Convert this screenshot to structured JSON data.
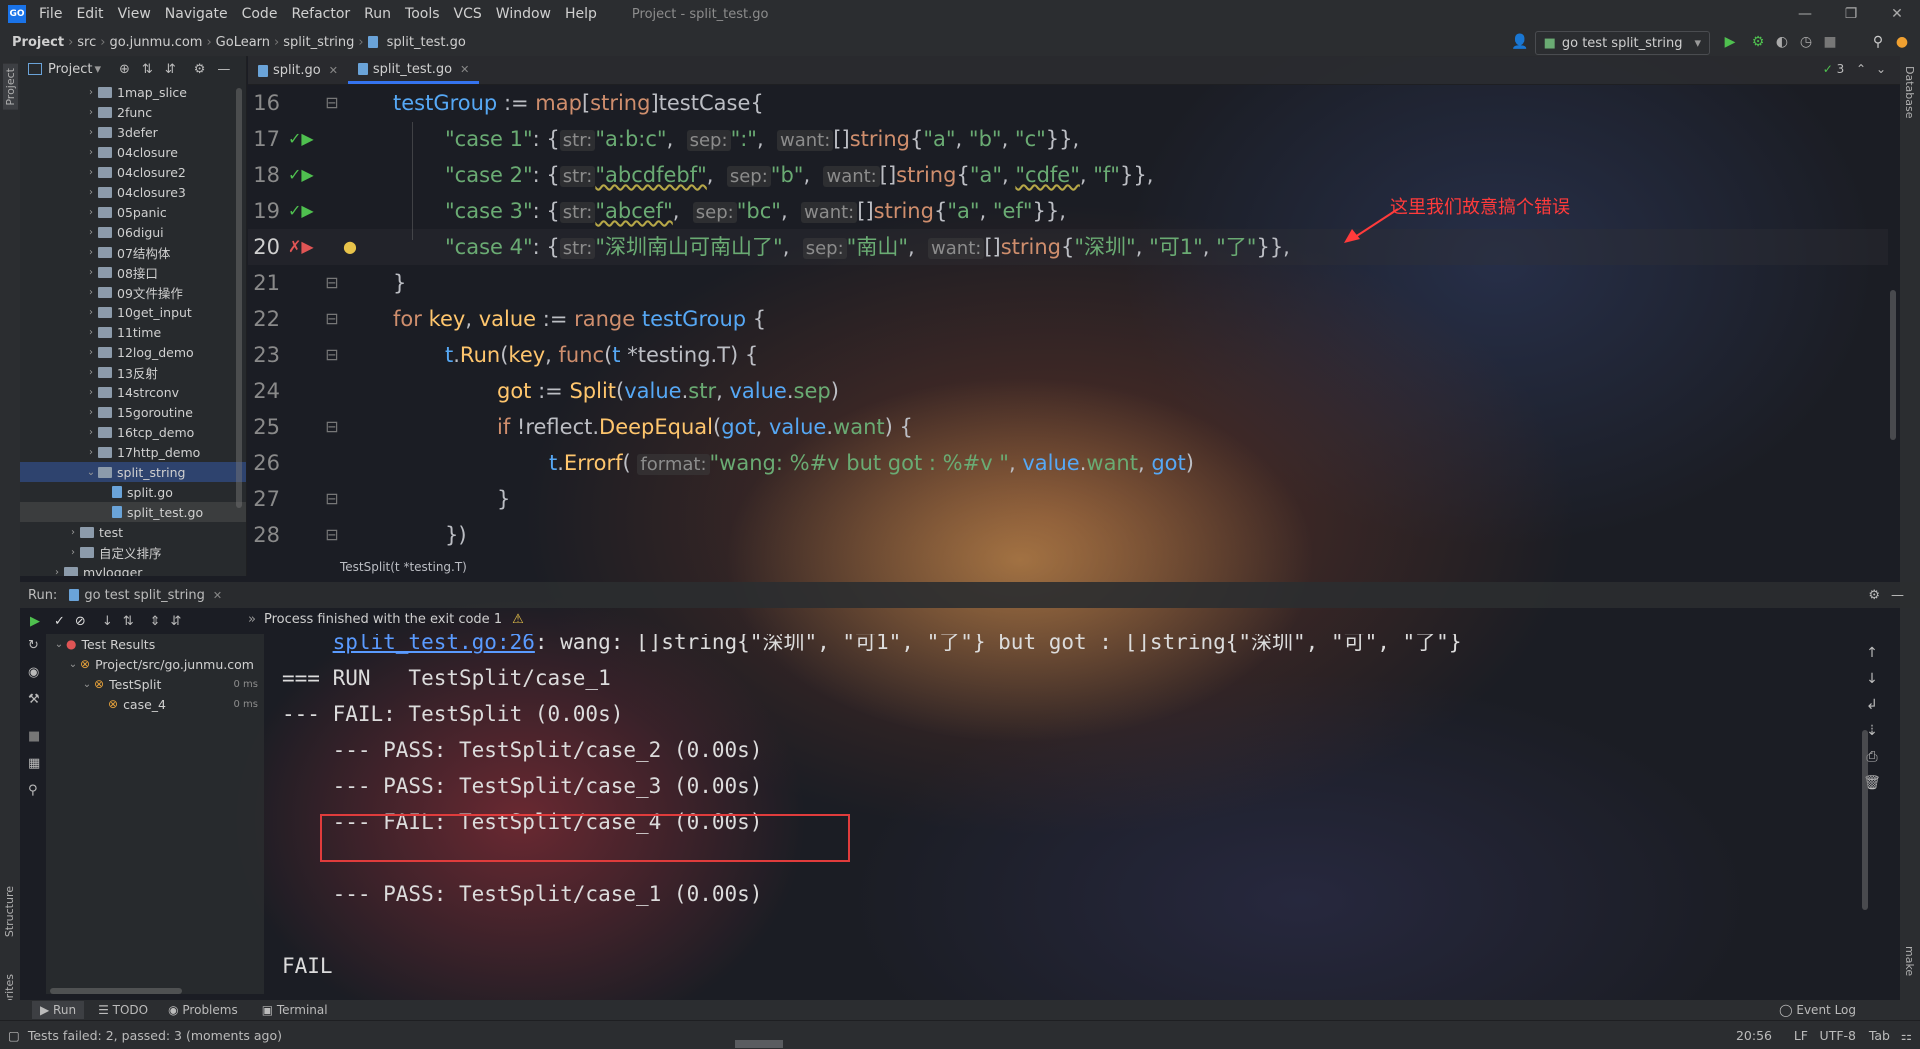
{
  "menubar": {
    "logo": "GO",
    "items": [
      "File",
      "Edit",
      "View",
      "Navigate",
      "Code",
      "Refactor",
      "Run",
      "Tools",
      "VCS",
      "Window",
      "Help"
    ],
    "title": "Project - split_test.go"
  },
  "breadcrumb": [
    "Project",
    "src",
    "go.junmu.com",
    "GoLearn",
    "split_string",
    "split_test.go"
  ],
  "run_config": "go test split_string",
  "project_panel": {
    "title": "Project",
    "tree": [
      {
        "label": "1map_slice",
        "indent": 1,
        "type": "folder"
      },
      {
        "label": "2func",
        "indent": 1,
        "type": "folder"
      },
      {
        "label": "3defer",
        "indent": 1,
        "type": "folder"
      },
      {
        "label": "04closure",
        "indent": 1,
        "type": "folder"
      },
      {
        "label": "04closure2",
        "indent": 1,
        "type": "folder"
      },
      {
        "label": "04closure3",
        "indent": 1,
        "type": "folder"
      },
      {
        "label": "05panic",
        "indent": 1,
        "type": "folder"
      },
      {
        "label": "06digui",
        "indent": 1,
        "type": "folder"
      },
      {
        "label": "07结构体",
        "indent": 1,
        "type": "folder"
      },
      {
        "label": "08接口",
        "indent": 1,
        "type": "folder"
      },
      {
        "label": "09文件操作",
        "indent": 1,
        "type": "folder"
      },
      {
        "label": "10get_input",
        "indent": 1,
        "type": "folder"
      },
      {
        "label": "11time",
        "indent": 1,
        "type": "folder"
      },
      {
        "label": "12log_demo",
        "indent": 1,
        "type": "folder"
      },
      {
        "label": "13反射",
        "indent": 1,
        "type": "folder"
      },
      {
        "label": "14strconv",
        "indent": 1,
        "type": "folder"
      },
      {
        "label": "15goroutine",
        "indent": 1,
        "type": "folder"
      },
      {
        "label": "16tcp_demo",
        "indent": 1,
        "type": "folder"
      },
      {
        "label": "17http_demo",
        "indent": 1,
        "type": "folder"
      },
      {
        "label": "split_string",
        "indent": 1,
        "type": "folder",
        "open": true,
        "selected": true
      },
      {
        "label": "split.go",
        "indent": 2,
        "type": "file"
      },
      {
        "label": "split_test.go",
        "indent": 2,
        "type": "file",
        "active": true
      },
      {
        "label": "test",
        "indent": 0,
        "type": "folder"
      },
      {
        "label": "自定义排序",
        "indent": 0,
        "type": "folder"
      },
      {
        "label": "mylogger",
        "indent": -1,
        "type": "folder"
      }
    ]
  },
  "tabs": [
    {
      "label": "split.go",
      "active": false
    },
    {
      "label": "split_test.go",
      "active": true
    }
  ],
  "editor": {
    "inspection_count": "3",
    "annotation": "这里我们故意搞个错误",
    "footer_crumb": "TestSplit(t *testing.T)",
    "line_numbers": [
      "16",
      "17",
      "18",
      "19",
      "20",
      "21",
      "22",
      "23",
      "24",
      "25",
      "26",
      "27",
      "28"
    ],
    "lines": {
      "l16": {
        "a": "testGroup",
        "b": " := ",
        "c": "map",
        "d": "[",
        "e": "string",
        "f": "]",
        "g": "testCase",
        "h": "{"
      },
      "l17": {
        "key": "\"case 1\"",
        "hs": "str:",
        "s": "\"a:b:c\"",
        "hp": "sep:",
        "p": "\":\"",
        "hw": "want:",
        "w1": "\"a\"",
        "w2": "\"b\"",
        "w3": "\"c\""
      },
      "l18": {
        "key": "\"case 2\"",
        "hs": "str:",
        "s": "\"abcdfebf\"",
        "hp": "sep:",
        "p": "\"b\"",
        "hw": "want:",
        "w1": "\"a\"",
        "w2": "\"cdfe\"",
        "w3": "\"f\""
      },
      "l19": {
        "key": "\"case 3\"",
        "hs": "str:",
        "s": "\"abcef\"",
        "hp": "sep:",
        "p": "\"bc\"",
        "hw": "want:",
        "w1": "\"a\"",
        "w2": "\"ef\""
      },
      "l20": {
        "key": "\"case 4\"",
        "hs": "str:",
        "s": "\"深圳南山可南山了\"",
        "hp": "sep:",
        "p": "\"南山\"",
        "hw": "want:",
        "w1": "\"深圳\"",
        "w2": "\"可1\"",
        "w3": "\"了\""
      },
      "l26": {
        "hf": "format:",
        "fmt": "\"wang: %#v but got : %#v \""
      }
    }
  },
  "run_panel": {
    "label": "Run:",
    "tab": "go test split_string",
    "status": "Process finished with the exit code 1",
    "tree": [
      {
        "label": "Test Results",
        "indent": 0,
        "time": ""
      },
      {
        "label": "Project/src/go.junmu.com",
        "indent": 1,
        "time": ""
      },
      {
        "label": "TestSplit",
        "indent": 2,
        "time": "0 ms"
      },
      {
        "label": "case_4",
        "indent": 3,
        "time": "0 ms"
      }
    ],
    "output": [
      {
        "link": "split_test.go:26",
        "text": ": wang: []string{\"深圳\", \"可1\", \"了\"} but got : []string{\"深圳\", \"可\", \"了\"}"
      },
      {
        "text": "=== RUN   TestSplit/case_1"
      },
      {
        "text": "--- FAIL: TestSplit (0.00s)"
      },
      {
        "text": "    --- PASS: TestSplit/case_2 (0.00s)"
      },
      {
        "text": "    --- PASS: TestSplit/case_3 (0.00s)"
      },
      {
        "text": "    --- FAIL: TestSplit/case_4 (0.00s)"
      },
      {
        "text": ""
      },
      {
        "text": "    --- PASS: TestSplit/case_1 (0.00s)"
      },
      {
        "text": ""
      },
      {
        "text": "FAIL"
      }
    ]
  },
  "bottom_tabs": [
    "Run",
    "TODO",
    "Problems",
    "Terminal"
  ],
  "event_log": "Event Log",
  "status": {
    "message": "Tests failed: 2, passed: 3 (moments ago)",
    "position": "20:56",
    "line_sep": "LF",
    "encoding": "UTF-8",
    "indent": "Tab"
  },
  "side_labels": {
    "project": "Project",
    "structure": "Structure",
    "favorites": "Favorites",
    "database": "Database",
    "make": "make"
  },
  "colors": {
    "accent": "#3574f0",
    "error": "#e03c3c",
    "string": "#6aab73",
    "keyword": "#cf8e6d"
  }
}
